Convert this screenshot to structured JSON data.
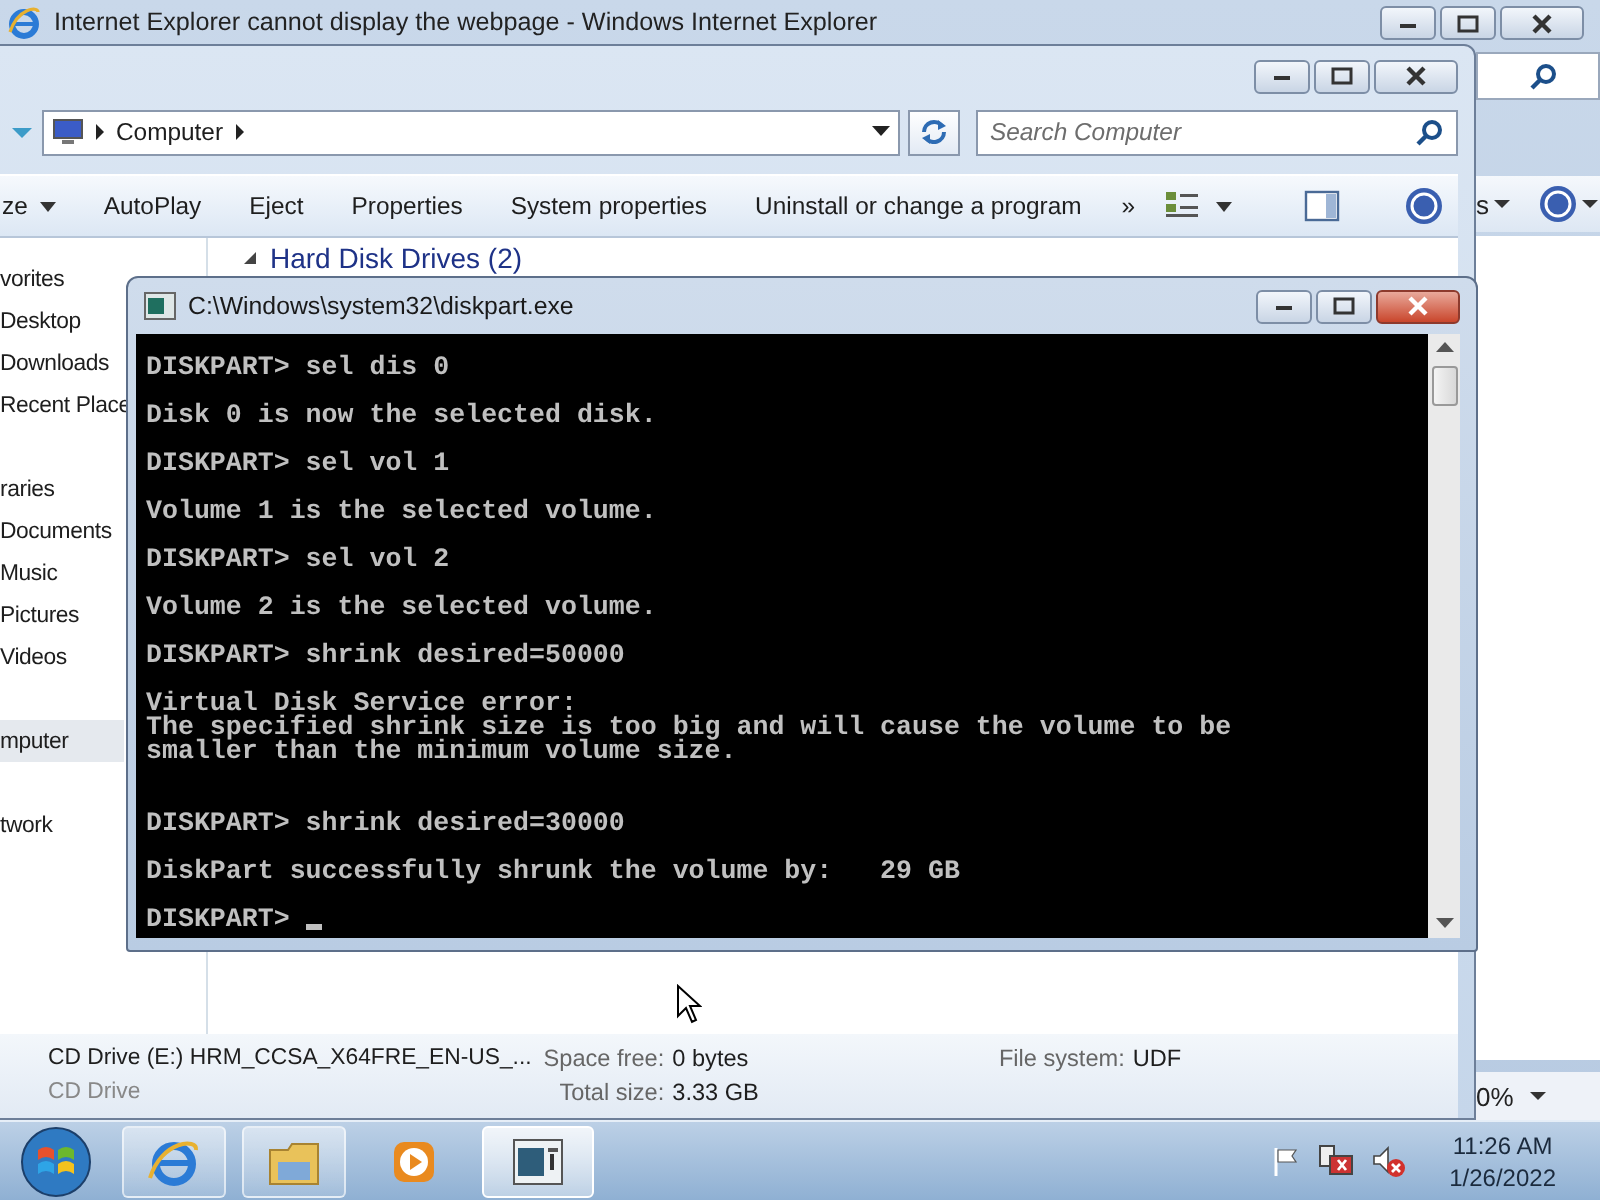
{
  "ie_window": {
    "title": "Internet Explorer cannot display the webpage - Windows Internet Explorer",
    "toolbar_text": "s",
    "zoom": "0%"
  },
  "explorer": {
    "address": "Computer",
    "search": {
      "placeholder": "Search Computer"
    },
    "toolbar": [
      {
        "label": "ze",
        "kind": "menu"
      },
      {
        "label": "AutoPlay",
        "kind": "button"
      },
      {
        "label": "Eject",
        "kind": "button"
      },
      {
        "label": "Properties",
        "kind": "button"
      },
      {
        "label": "System properties",
        "kind": "button"
      },
      {
        "label": "Uninstall or change a program",
        "kind": "button"
      },
      {
        "label": "»",
        "kind": "more"
      }
    ],
    "sidebar": [
      {
        "label": "vorites",
        "selected": false,
        "children": [
          {
            "label": "Desktop",
            "selected": false
          },
          {
            "label": "Downloads",
            "selected": false
          },
          {
            "label": "Recent Place",
            "selected": false
          }
        ]
      },
      {
        "label": "raries",
        "selected": false,
        "children": [
          {
            "label": "Documents",
            "selected": false
          },
          {
            "label": "Music",
            "selected": false
          },
          {
            "label": "Pictures",
            "selected": false
          },
          {
            "label": "Videos",
            "selected": false
          }
        ]
      },
      {
        "label": "mputer",
        "selected": true
      },
      {
        "label": "twork",
        "selected": false
      }
    ],
    "group_heading": "Hard Disk Drives (2)",
    "details": {
      "name": "CD Drive (E:) HRM_CCSA_X64FRE_EN-US_...",
      "type": "CD Drive",
      "fields": [
        {
          "label": "Space free:",
          "value": "0 bytes"
        },
        {
          "label": "Total size:",
          "value": "3.33 GB"
        },
        {
          "label": "File system:",
          "value": "UDF"
        }
      ]
    }
  },
  "console": {
    "title": "C:\\Windows\\system32\\diskpart.exe",
    "blocks": [
      {
        "kind": "prompt",
        "lines": [
          "DISKPART> sel dis 0"
        ]
      },
      {
        "kind": "output",
        "lines": [
          "Disk 0 is now the selected disk."
        ]
      },
      {
        "kind": "prompt",
        "lines": [
          "DISKPART> sel vol 1"
        ]
      },
      {
        "kind": "output",
        "lines": [
          "Volume 1 is the selected volume."
        ]
      },
      {
        "kind": "prompt",
        "lines": [
          "DISKPART> sel vol 2"
        ]
      },
      {
        "kind": "output",
        "lines": [
          "Volume 2 is the selected volume."
        ]
      },
      {
        "kind": "prompt",
        "lines": [
          "DISKPART> shrink desired=50000"
        ]
      },
      {
        "kind": "error",
        "lines": [
          "Virtual Disk Service error:",
          "The specified shrink size is too big and will cause the volume to be",
          "smaller than the minimum volume size."
        ]
      },
      {
        "kind": "prompt",
        "lines": [
          "DISKPART> shrink desired=30000"
        ]
      },
      {
        "kind": "output",
        "lines": [
          "DiskPart successfully shrunk the volume by:   29 GB"
        ]
      },
      {
        "kind": "prompt",
        "lines": [
          "DISKPART> "
        ],
        "cursor": true
      }
    ]
  },
  "taskbar": {
    "apps": [
      {
        "kind": "browser",
        "selected": false
      },
      {
        "kind": "folder",
        "selected": false
      },
      {
        "kind": "media",
        "selected": false
      },
      {
        "kind": "console",
        "selected": true
      }
    ],
    "time": "11:26 AM",
    "date": "1/26/2022"
  }
}
